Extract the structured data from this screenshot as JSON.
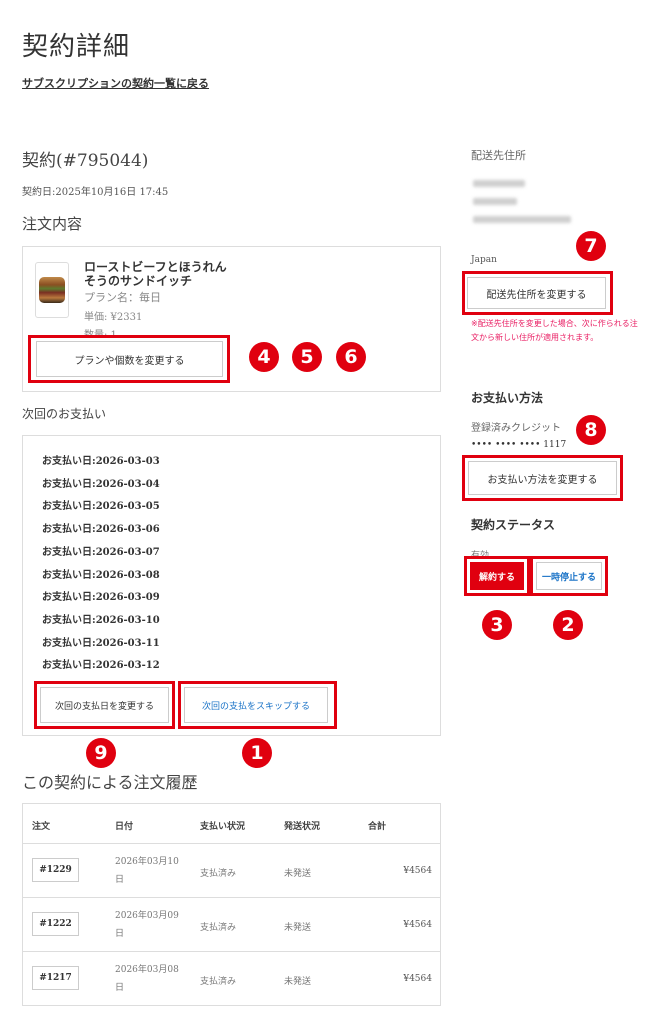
{
  "page": {
    "title": "契約詳細",
    "back_link": "サブスクリプションの契約一覧に戻る"
  },
  "contract": {
    "id": "契約(#795044)",
    "date": "契約日:2025年10月16日 17:45"
  },
  "order": {
    "heading": "注文内容",
    "product_name": "ローストビーフとほうれんそうのサンドイッチ",
    "plan": "プラン名：毎日",
    "price": "単価: ¥2331",
    "quantity": "数量: 1",
    "change_button": "プランや個数を変更する"
  },
  "next_payment": {
    "heading": "次回のお支払い",
    "dates": [
      "お支払い日:2026-03-03",
      "お支払い日:2026-03-04",
      "お支払い日:2026-03-05",
      "お支払い日:2026-03-06",
      "お支払い日:2026-03-07",
      "お支払い日:2026-03-08",
      "お支払い日:2026-03-09",
      "お支払い日:2026-03-10",
      "お支払い日:2026-03-11",
      "お支払い日:2026-03-12"
    ],
    "change_date_button": "次回の支払日を変更する",
    "skip_button": "次回の支払をスキップする"
  },
  "history": {
    "heading": "この契約による注文履歴",
    "columns": [
      "注文",
      "日付",
      "支払い状況",
      "発送状況",
      "合計"
    ],
    "rows": [
      {
        "order": "#1229",
        "date": "2026年03月10日",
        "payment": "支払済み",
        "shipping": "未発送",
        "total": "¥4564"
      },
      {
        "order": "#1222",
        "date": "2026年03月09日",
        "payment": "支払済み",
        "shipping": "未発送",
        "total": "¥4564"
      },
      {
        "order": "#1217",
        "date": "2026年03月08日",
        "payment": "支払済み",
        "shipping": "未発送",
        "total": "¥4564"
      }
    ]
  },
  "shipping": {
    "heading": "配送先住所",
    "country": "Japan",
    "change_button": "配送先住所を変更する",
    "note": "※配送先住所を変更した場合、次に作られる注文から新しい住所が適用されます。"
  },
  "payment_method": {
    "heading": "お支払い方法",
    "card_label": "登録済みクレジット",
    "card_number": "•••• •••• •••• 1117",
    "change_button": "お支払い方法を変更する"
  },
  "status": {
    "heading": "契約ステータス",
    "value": "有効",
    "cancel_button": "解約する",
    "pause_button": "一時停止する"
  },
  "annotations": {
    "colors": {
      "highlight": "#e0000f",
      "badge": "#e0000f",
      "cancel_button_bg": "#e0000f",
      "note_text": "#e91e63",
      "link_blue": "#1a73c7"
    },
    "badges": [
      "1",
      "2",
      "3",
      "4",
      "5",
      "6",
      "7",
      "8",
      "9"
    ]
  }
}
